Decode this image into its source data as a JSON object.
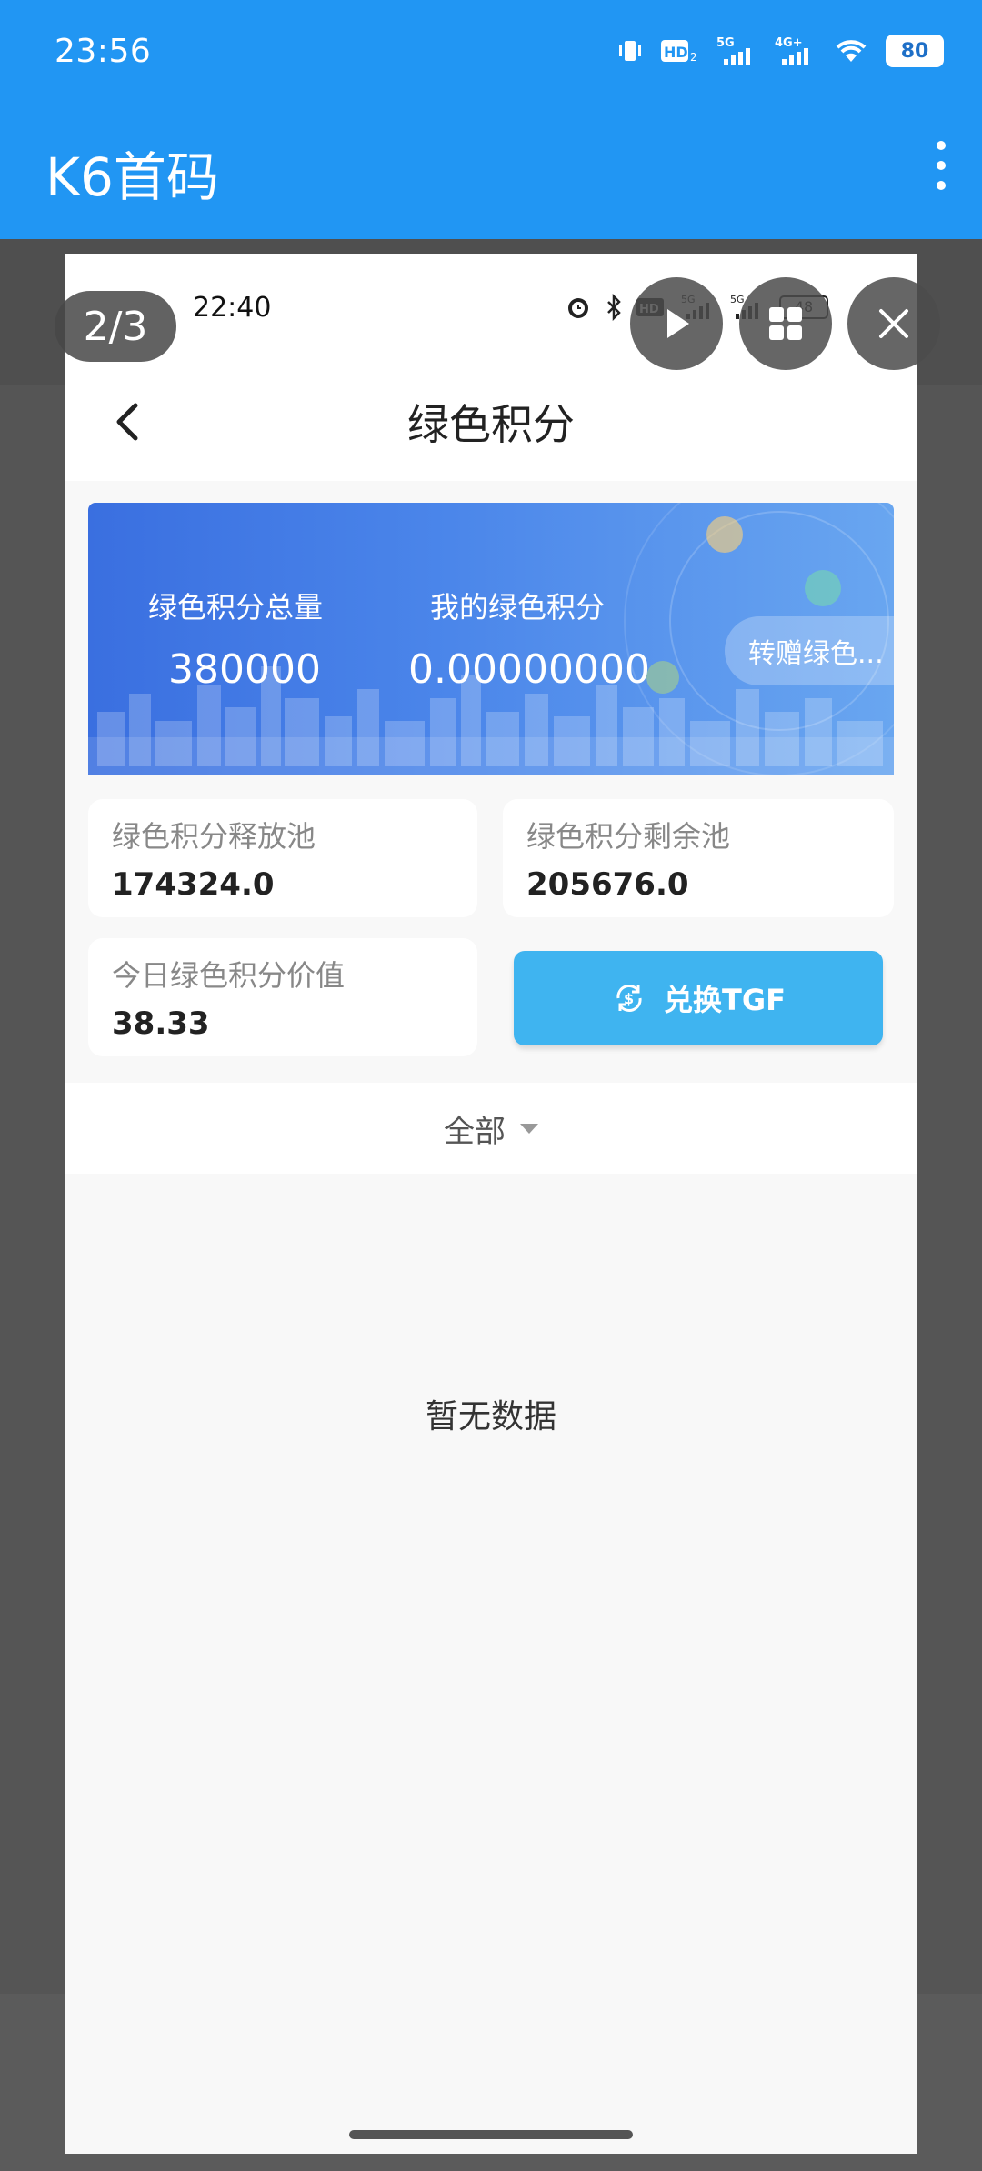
{
  "outer": {
    "time": "23:56",
    "battery": "80",
    "app_title": "K6首码"
  },
  "viewer": {
    "page_counter": "2/3"
  },
  "inner": {
    "time": "22:40",
    "battery": "48",
    "title": "绿色积分",
    "banner": {
      "total_label": "绿色积分总量",
      "total_value": "380000",
      "mine_label": "我的绿色积分",
      "mine_value": "0.00000000",
      "transfer_label": "转赠绿色..."
    },
    "cards": {
      "release_label": "绿色积分释放池",
      "release_value": "174324.0",
      "remain_label": "绿色积分剩余池",
      "remain_value": "205676.0",
      "today_label": "今日绿色积分价值",
      "today_value": "38.33"
    },
    "exchange_label": "兑换TGF",
    "filter_label": "全部",
    "empty_text": "暂无数据"
  },
  "colors": {
    "app_bar": "#2196f3",
    "exchange_button": "#3fb4f0"
  }
}
